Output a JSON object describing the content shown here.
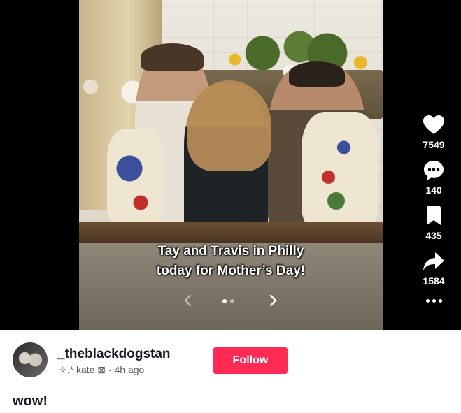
{
  "post": {
    "caption_line1": "Tay and Travis in Philly",
    "caption_line2": "today for Mother’s Day!",
    "carousel": {
      "current": 1,
      "total": 2
    }
  },
  "actions": {
    "likes": "7549",
    "comments": "140",
    "saves": "435",
    "shares": "1584"
  },
  "icons": [
    "heart-icon",
    "comment-icon",
    "bookmark-icon",
    "share-icon",
    "more-icon",
    "chevron-left-icon",
    "chevron-right-icon"
  ],
  "author": {
    "username": "_theblackdogstan",
    "subline": "✧.* kate ⊠ · 4h ago",
    "follow_label": "Follow"
  },
  "description": "wow!",
  "colors": {
    "follow_bg": "#fe2c55",
    "page_bg": "#000000",
    "info_bg": "#ffffff"
  }
}
